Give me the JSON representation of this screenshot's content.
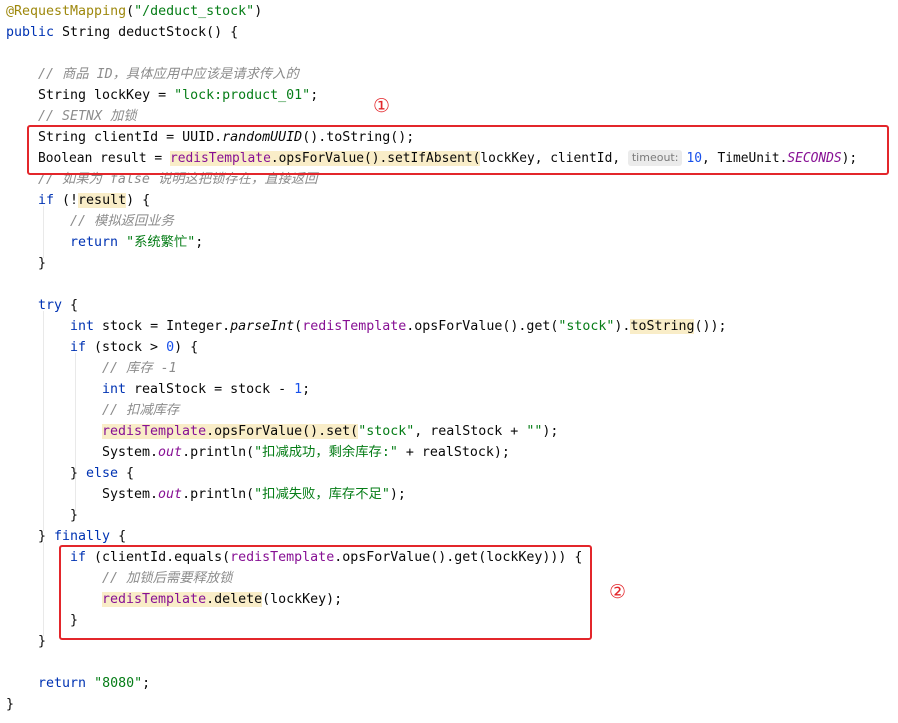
{
  "code": {
    "l1": {
      "anno": "@RequestMapping",
      "p1": "(",
      "s1": "\"/deduct_stock\"",
      "p2": ")"
    },
    "l2": {
      "k1": "public",
      "t1": " String deductStock() {"
    },
    "l4": {
      "c1": "// 商品 ID，具体应用中应该是请求传入的"
    },
    "l5": {
      "t1": "String lockKey = ",
      "s1": "\"lock:product_01\"",
      "t2": ";"
    },
    "l6": {
      "c1": "// SETNX 加锁"
    },
    "l7": {
      "t1": "String clientId = UUID.",
      "i1": "randomUUID",
      "t2": "().toString();"
    },
    "l8": {
      "t1": "Boolean result = ",
      "h1": "redisTemplate",
      "h2": ".opsForValue().setIfAbsent(",
      "t2": "lockKey, clientId, ",
      "hint": "timeout:",
      "n1": "10",
      "t3": ", TimeUnit.",
      "st1": "SECONDS",
      "t4": ");"
    },
    "l9": {
      "c1": "// 如果为 false 说明这把锁存在，直接返回"
    },
    "l10": {
      "k1": "if",
      "t1": " (!",
      "h1": "result",
      "t2": ") {"
    },
    "l11": {
      "c1": "// 模拟返回业务"
    },
    "l12": {
      "k1": "return",
      "t1": " ",
      "s1": "\"系统繁忙\"",
      "t2": ";"
    },
    "l13": {
      "t1": "}"
    },
    "l15": {
      "k1": "try",
      "t1": " {"
    },
    "l16": {
      "k1": "int",
      "t1": " stock = Integer.",
      "i1": "parseInt",
      "t2": "(",
      "f1": "redisTemplate",
      "t3": ".opsForValue().get(",
      "s1": "\"stock\"",
      "t4": ").",
      "h1": "toString",
      "t5": "());"
    },
    "l17": {
      "k1": "if",
      "t1": " (stock > ",
      "n1": "0",
      "t2": ") {"
    },
    "l18": {
      "c1": "// 库存 -1"
    },
    "l19": {
      "k1": "int",
      "t1": " realStock = stock - ",
      "n1": "1",
      "t2": ";"
    },
    "l20": {
      "c1": "// 扣减库存"
    },
    "l21": {
      "h1": "redisTemplate",
      "h2": ".opsForValue().set(",
      "s1": "\"stock\"",
      "t1": ", realStock + ",
      "s2": "\"\"",
      "t2": ");"
    },
    "l22": {
      "t1": "System.",
      "st1": "out",
      "t2": ".println(",
      "s1": "\"扣减成功，剩余库存:\"",
      "t3": " + realStock);"
    },
    "l23": {
      "t1": "} ",
      "k1": "else",
      "t2": " {"
    },
    "l24": {
      "t1": "System.",
      "st1": "out",
      "t2": ".println(",
      "s1": "\"扣减失败，库存不足\"",
      "t3": ");"
    },
    "l25": {
      "t1": "}"
    },
    "l26": {
      "t1": "} ",
      "k1": "finally",
      "t2": " {"
    },
    "l27": {
      "k1": "if",
      "t1": " (clientId.equals(",
      "f1": "redisTemplate",
      "t2": ".opsForValue().get(lockKey))) {"
    },
    "l28": {
      "c1": "// 加锁后需要释放锁"
    },
    "l29": {
      "h1": "redisTemplate",
      "h2": ".delete",
      "t1": "(lockKey);"
    },
    "l30": {
      "t1": "}"
    },
    "l31": {
      "t1": "}"
    },
    "l33": {
      "k1": "return",
      "t1": " ",
      "s1": "\"8080\"",
      "t2": ";"
    },
    "l34": {
      "t1": "}"
    }
  },
  "markers": {
    "m1": "①",
    "m2": "②"
  },
  "colors": {
    "keyword": "#0033b3",
    "string": "#067d17",
    "number": "#1750eb",
    "comment": "#8c8c8c",
    "annotation": "#9e880d",
    "field": "#871094",
    "highlight": "#f9edc8",
    "box": "#e3262b"
  }
}
